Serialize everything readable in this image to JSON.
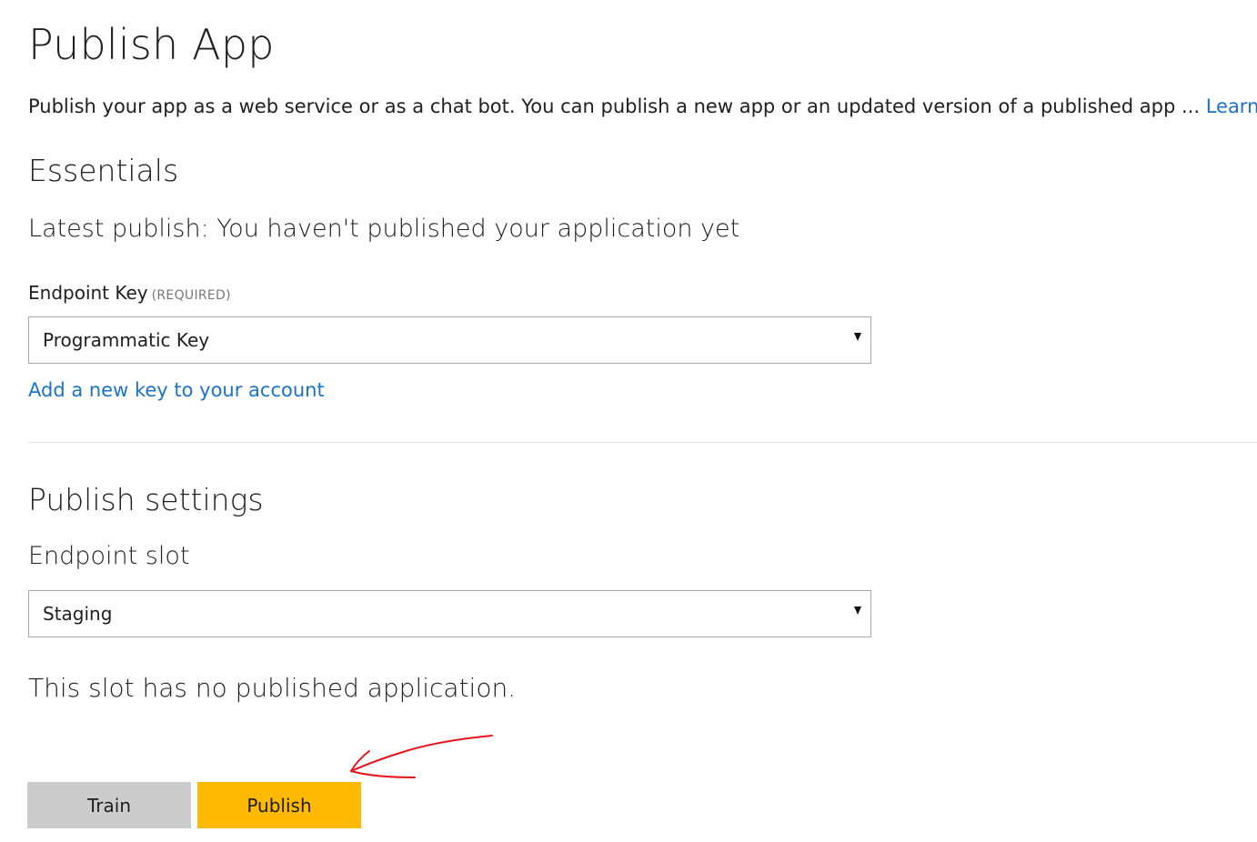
{
  "page": {
    "title": "Publish App",
    "intro_text": "Publish your app as a web service or as a chat bot. You can publish a new app or an updated version of a published app ... ",
    "learn_more_link": "Learn more"
  },
  "essentials": {
    "heading": "Essentials",
    "latest_publish": "Latest publish: You haven't published your application yet",
    "endpoint_key_label": "Endpoint Key",
    "endpoint_key_required": "(REQUIRED)",
    "endpoint_key_selected": "Programmatic Key",
    "add_key_link": "Add a new key to your account"
  },
  "publish_settings": {
    "heading": "Publish settings",
    "endpoint_slot_label": "Endpoint slot",
    "endpoint_slot_selected": "Staging",
    "slot_status": "This slot has no published application."
  },
  "actions": {
    "train_label": "Train",
    "publish_label": "Publish"
  },
  "colors": {
    "link": "#1a73c9",
    "publish_button": "#ffb900",
    "train_button": "#cccccc",
    "annotation_arrow": "#e8141c"
  },
  "icons": {
    "dropdown_caret": "caret-down-icon",
    "annotation": "hand-drawn-arrow-icon"
  }
}
